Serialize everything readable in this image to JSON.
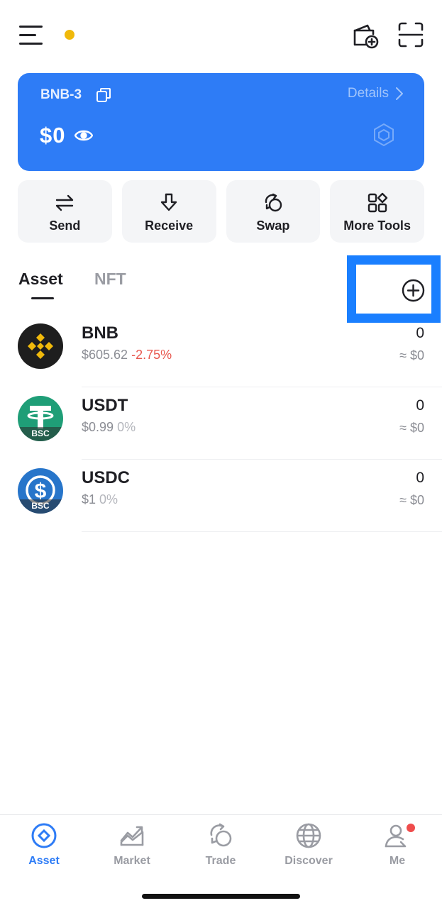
{
  "wallet": {
    "name": "BNB-3",
    "details_label": "Details",
    "balance": "$0"
  },
  "actions": [
    {
      "label": "Send",
      "icon": "send-arrows-icon"
    },
    {
      "label": "Receive",
      "icon": "receive-arrow-icon"
    },
    {
      "label": "Swap",
      "icon": "swap-icon"
    },
    {
      "label": "More Tools",
      "icon": "grid-tools-icon"
    }
  ],
  "tabs": {
    "asset": "Asset",
    "nft": "NFT"
  },
  "assets": [
    {
      "symbol": "BNB",
      "price": "$605.62",
      "change": "-2.75%",
      "amount": "0",
      "value": "≈ $0",
      "badge": ""
    },
    {
      "symbol": "USDT",
      "price": "$0.99",
      "change": "0%",
      "amount": "0",
      "value": "≈ $0",
      "badge": "BSC"
    },
    {
      "symbol": "USDC",
      "price": "$1",
      "change": "0%",
      "amount": "0",
      "value": "≈ $0",
      "badge": "BSC"
    }
  ],
  "nav": [
    {
      "label": "Asset",
      "active": true
    },
    {
      "label": "Market"
    },
    {
      "label": "Trade"
    },
    {
      "label": "Discover"
    },
    {
      "label": "Me"
    }
  ],
  "colors": {
    "accent": "#2e7cf6",
    "negative": "#e8584f",
    "notification": "#f0b90b",
    "highlight": "#1a7fff"
  }
}
